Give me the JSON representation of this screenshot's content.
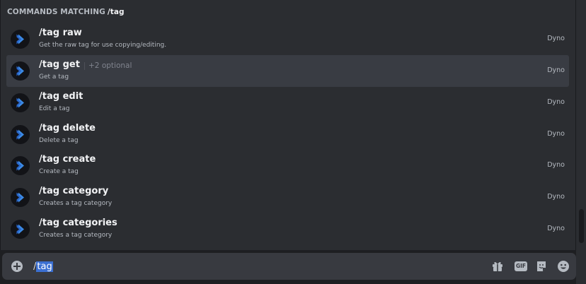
{
  "popup": {
    "header_prefix": "COMMANDS MATCHING",
    "header_query": "/tag"
  },
  "commands": [
    {
      "name": "/tag raw",
      "description": "Get the raw tag for use copying/editing.",
      "bot": "Dyno",
      "optional": ""
    },
    {
      "name": "/tag get",
      "description": "Get a tag",
      "bot": "Dyno",
      "optional": "+2 optional"
    },
    {
      "name": "/tag edit",
      "description": "Edit a tag",
      "bot": "Dyno",
      "optional": ""
    },
    {
      "name": "/tag delete",
      "description": "Delete a tag",
      "bot": "Dyno",
      "optional": ""
    },
    {
      "name": "/tag create",
      "description": "Create a tag",
      "bot": "Dyno",
      "optional": ""
    },
    {
      "name": "/tag category",
      "description": "Creates a tag category",
      "bot": "Dyno",
      "optional": ""
    },
    {
      "name": "/tag categories",
      "description": "Creates a tag category",
      "bot": "Dyno",
      "optional": ""
    }
  ],
  "selected_index": 1,
  "composer": {
    "text_prefix": "/",
    "text_selected": "tag",
    "gif_label": "GIF"
  },
  "icons": {
    "bot_avatar": "dyno-chevron-icon",
    "add": "plus-circle-icon",
    "gift": "gift-icon",
    "gif": "gif-icon",
    "sticker": "sticker-icon",
    "emoji": "emoji-icon"
  },
  "colors": {
    "background": "#2b2d31",
    "selected_row": "#393c43",
    "composer": "#383a40",
    "accent": "#3b6fd1"
  }
}
